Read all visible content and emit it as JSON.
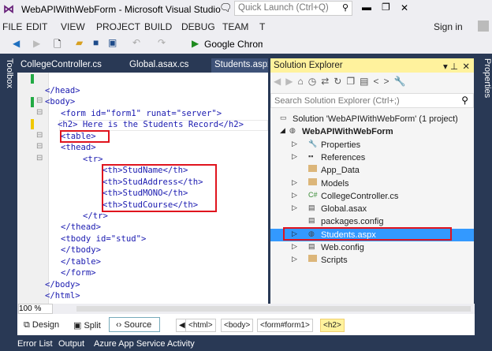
{
  "window": {
    "title": "WebAPIWithWebForm - Microsoft Visual Studio",
    "quick_launch_placeholder": "Quick Launch (Ctrl+Q)",
    "sign_in": "Sign in"
  },
  "menu": [
    "FILE",
    "EDIT",
    "VIEW",
    "PROJECT",
    "BUILD",
    "DEBUG",
    "TEAM",
    "T"
  ],
  "toolbar": {
    "run_target": "Google Chrome"
  },
  "side": {
    "toolbox": "Toolbox",
    "properties": "Properties"
  },
  "tabs": [
    "CollegeController.cs",
    "Global.asax.cs",
    "Students.aspx"
  ],
  "code_lines": [
    {
      "indent": 0,
      "text": "</head>"
    },
    {
      "indent": 0,
      "text": "<body>"
    },
    {
      "indent": 1,
      "text": "<form id=\"form1\" runat=\"server\">"
    },
    {
      "indent": 1,
      "text": "<h2> Here is the Students Record</h2>"
    },
    {
      "indent": 1,
      "text": "<table>"
    },
    {
      "indent": 1,
      "text": "<thead>"
    },
    {
      "indent": 2,
      "text": "<tr>"
    },
    {
      "indent": 3,
      "text": "<th>StudName</th>"
    },
    {
      "indent": 3,
      "text": "<th>StudAddress</th>"
    },
    {
      "indent": 3,
      "text": "<th>StudMONO</th>"
    },
    {
      "indent": 3,
      "text": "<th>StudCourse</th>"
    },
    {
      "indent": 2,
      "text": "</tr>"
    },
    {
      "indent": 1,
      "text": "</thead>"
    },
    {
      "indent": 1,
      "text": "<tbody id=\"stud\">"
    },
    {
      "indent": 1,
      "text": "</tbody>"
    },
    {
      "indent": 1,
      "text": "</table>"
    },
    {
      "indent": 1,
      "text": "</form>"
    },
    {
      "indent": 0,
      "text": "</body>"
    },
    {
      "indent": 0,
      "text": "</html>"
    }
  ],
  "solution_explorer": {
    "title": "Solution Explorer",
    "search_placeholder": "Search Solution Explorer (Ctrl+;)",
    "items": [
      {
        "label": "Solution 'WebAPIWithWebForm' (1 project)",
        "level": 0,
        "icon": "solution"
      },
      {
        "label": "WebAPIWithWebForm",
        "level": 1,
        "icon": "web-project",
        "bold": true
      },
      {
        "label": "Properties",
        "level": 2,
        "icon": "wrench",
        "expand": true
      },
      {
        "label": "References",
        "level": 2,
        "icon": "references",
        "expand": true
      },
      {
        "label": "App_Data",
        "level": 2,
        "icon": "folder"
      },
      {
        "label": "Models",
        "level": 2,
        "icon": "folder",
        "expand": true
      },
      {
        "label": "CollegeController.cs",
        "level": 2,
        "icon": "csharp",
        "expand": true
      },
      {
        "label": "Global.asax",
        "level": 2,
        "icon": "file",
        "expand": true
      },
      {
        "label": "packages.config",
        "level": 2,
        "icon": "file"
      },
      {
        "label": "Students.aspx",
        "level": 2,
        "icon": "web-file",
        "expand": true,
        "selected": true
      },
      {
        "label": "Web.config",
        "level": 2,
        "icon": "file",
        "expand": true
      },
      {
        "label": "Scripts",
        "level": 2,
        "icon": "folder",
        "expand": true
      }
    ]
  },
  "editor_bottom": {
    "zoom": "100 %",
    "design": "Design",
    "split": "Split",
    "source": "Source",
    "breadcrumbs": [
      "<html>",
      "<body>",
      "<form#form1>",
      "<h2>"
    ]
  },
  "status_tabs": [
    "Error List",
    "Output",
    "Azure App Service Activity"
  ]
}
